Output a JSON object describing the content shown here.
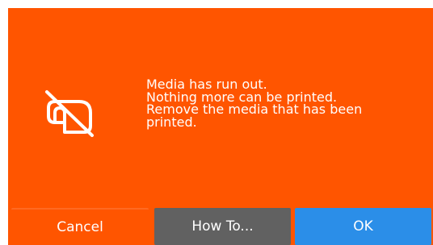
{
  "dialog": {
    "icon": "media-out-icon",
    "message_lines": [
      "Media has run out.",
      "Nothing more can be printed.",
      "Remove the media that has been",
      "printed."
    ]
  },
  "buttons": {
    "cancel_label": "Cancel",
    "howto_label": "How To...",
    "ok_label": "OK"
  },
  "colors": {
    "background": "#ff5500",
    "howto_button": "#616161",
    "ok_button": "#2b8ee8",
    "text": "#ffffff"
  }
}
